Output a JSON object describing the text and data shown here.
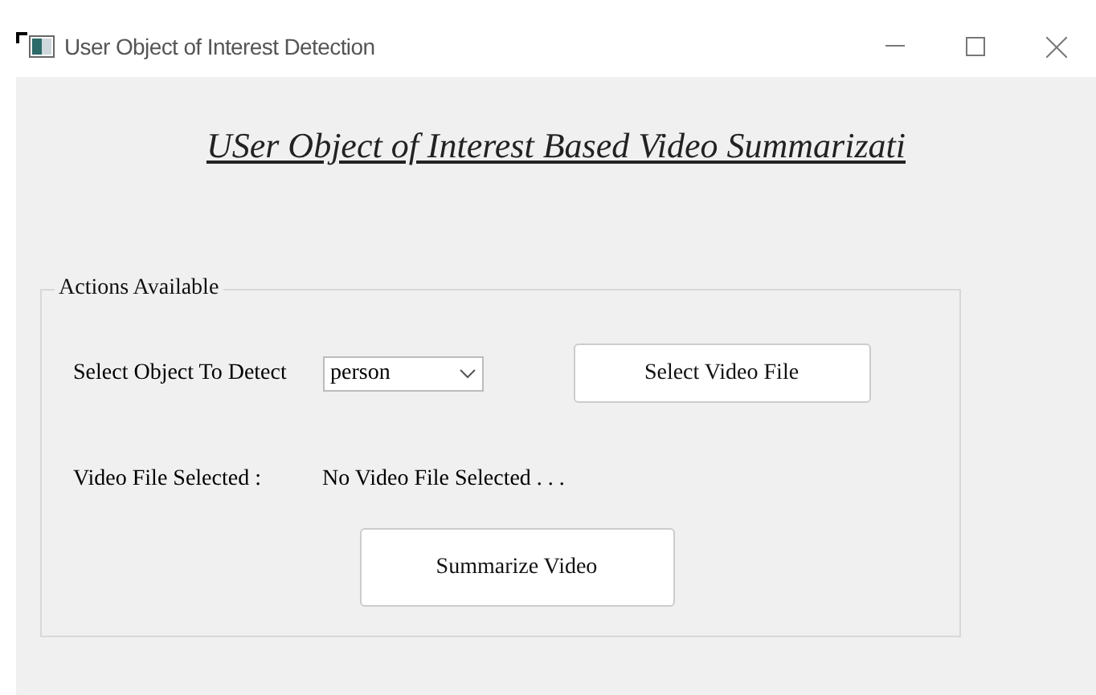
{
  "window": {
    "title": "User Object of Interest Detection"
  },
  "heading": "USer Object of Interest Based Video Summarizati",
  "group": {
    "title": "Actions Available",
    "object_label": "Select Object To Detect",
    "object_select": {
      "value": "person"
    },
    "select_button": "Select Video File",
    "file_label": "Video File Selected :",
    "file_value": "No Video File Selected . . .",
    "summarize_button": "Summarize Video"
  }
}
